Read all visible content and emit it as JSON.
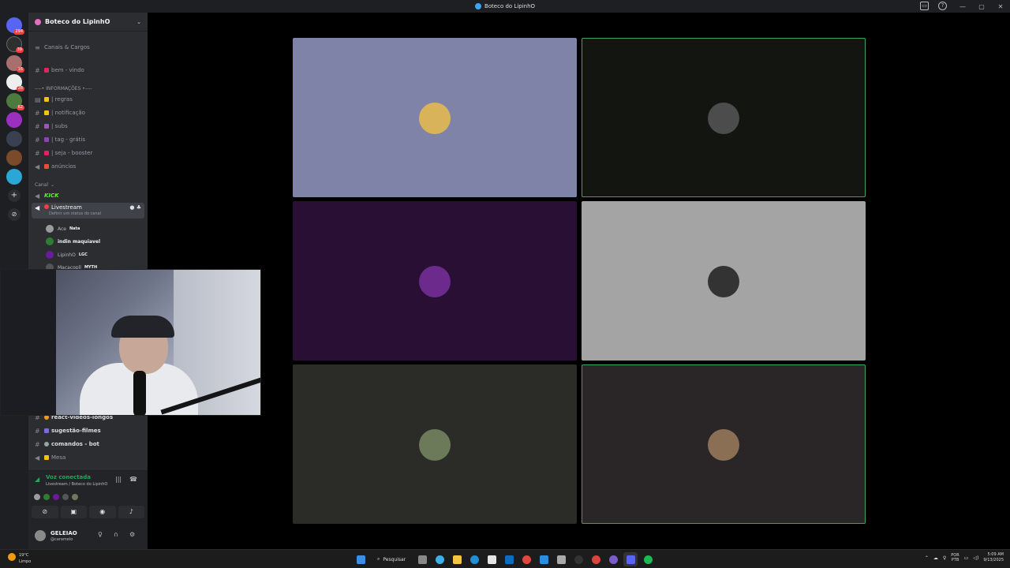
{
  "window": {
    "title": "Boteco do LipinhO",
    "minimize": "—",
    "maximize": "▢",
    "close": "✕"
  },
  "rail": {
    "servers": [
      {
        "name": "direct-messages",
        "badge": "294",
        "color": "#5865f2"
      },
      {
        "name": "server-1",
        "badge": "39",
        "color": "#2f2f2f"
      },
      {
        "name": "server-2",
        "badge": "16",
        "color": "#a86f6f"
      },
      {
        "name": "server-3",
        "badge": "28",
        "color": "#eeeeee"
      },
      {
        "name": "server-4",
        "badge": "62",
        "color": "#4d7a3e"
      },
      {
        "name": "server-5",
        "badge": "",
        "color": "#9b2fbf"
      },
      {
        "name": "server-6",
        "badge": "",
        "color": "#3b4050"
      },
      {
        "name": "server-7",
        "badge": "",
        "color": "#7a4a2a"
      },
      {
        "name": "server-8",
        "badge": "",
        "color": "#2aa7d6"
      }
    ],
    "add": "+",
    "discover": "⊘"
  },
  "sidebar": {
    "server_name": "Boteco do LipinhO",
    "channels_roles": "Canais & Cargos",
    "channels": [
      {
        "label": "bem - vindo",
        "icon": "#",
        "emoji": "#e0245e"
      },
      {
        "label": "----• INFORMAÇÕES •----",
        "icon": "",
        "emoji": ""
      },
      {
        "label": "| regras",
        "icon": "#",
        "emoji": "#f1c40f"
      },
      {
        "label": "| notificação",
        "icon": "#",
        "emoji": "#f1c40f"
      },
      {
        "label": "| subs",
        "icon": "#",
        "emoji": "#9b59b6"
      },
      {
        "label": "| tag - grátis",
        "icon": "#",
        "emoji": "#8e44ad"
      },
      {
        "label": "| seja - booster",
        "icon": "#",
        "emoji": "#e91e63"
      },
      {
        "label": "anúncios",
        "icon": "◀",
        "emoji": "#e74c3c"
      }
    ],
    "category_canal": "Canal",
    "kick_label": "KICK",
    "active_channel": {
      "label": "Livestream",
      "sub": "Definir um status do canal"
    },
    "voice_users": [
      {
        "name": "Ace",
        "tag": "Nata",
        "color": "#9c9c9c"
      },
      {
        "name": "indin maquiavel",
        "tag": "",
        "color": "#2e7d32"
      },
      {
        "name": "LipinhO",
        "tag": "LGC",
        "color": "#6a1b9a"
      },
      {
        "name": "Macacopll",
        "tag": "MYTH",
        "color": "#555555"
      }
    ],
    "lower_channels": [
      {
        "label": "react-videos-longos",
        "icon": "#"
      },
      {
        "label": "sugestão-filmes",
        "icon": "#"
      },
      {
        "label": "comandos - bot",
        "icon": "#"
      },
      {
        "label": "Mesa",
        "icon": "◀"
      }
    ]
  },
  "voice_panel": {
    "status": "Voz conectada",
    "location": "Livestream / Boteco do LipinhO"
  },
  "user": {
    "name": "GELEIAO",
    "handle": "@caramelo"
  },
  "grid": {
    "tiles": [
      {
        "name": "participant-1",
        "bg": "#8083a8",
        "avatar": "#d9b35a",
        "speaking": false
      },
      {
        "name": "participant-2",
        "bg": "#131511",
        "avatar": "#4c4c4c",
        "speaking": true
      },
      {
        "name": "participant-3",
        "bg": "#2a0f35",
        "avatar": "#6b2a8c",
        "speaking": false
      },
      {
        "name": "participant-4",
        "bg": "#a4a4a4",
        "avatar": "#333333",
        "speaking": false
      },
      {
        "name": "participant-5",
        "bg": "#2b2c27",
        "avatar": "#6d7a5a",
        "speaking": false
      },
      {
        "name": "participant-6",
        "bg": "#2a2627",
        "avatar": "#8a6f55",
        "speaking": true
      }
    ]
  },
  "taskbar": {
    "weather_temp": "19°C",
    "weather_desc": "Limpo",
    "search": "Pesquisar",
    "lang_1": "POR",
    "lang_2": "PTB",
    "time": "5:09 AM",
    "date": "9/13/2025"
  }
}
